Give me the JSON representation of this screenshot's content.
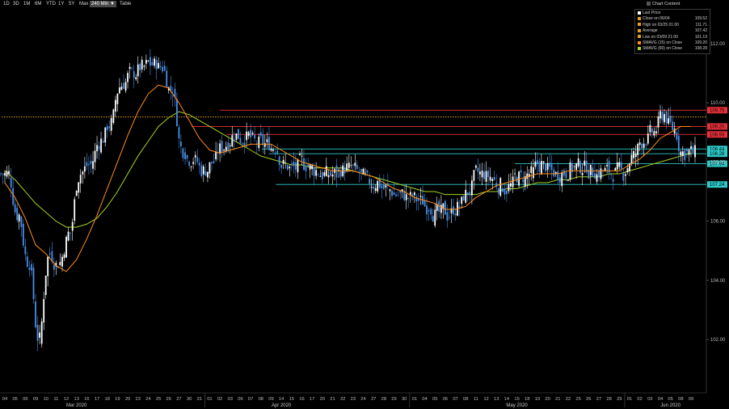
{
  "toolbar": {
    "ranges": [
      "1D",
      "3D",
      "1M",
      "6M",
      "YTD",
      "1Y",
      "5Y",
      "Max"
    ],
    "interval": "240 Min ▼",
    "table": "Table",
    "chart_content": "Chart Content"
  },
  "legend": {
    "rows": [
      {
        "label": "Last Price",
        "value": "",
        "color": "#ffffff"
      },
      {
        "label": "Close on 06/04",
        "value": "109.52",
        "color": "#e8a020"
      },
      {
        "label": "High on 03/25 01:00",
        "value": "111.71",
        "color": "#e8a020"
      },
      {
        "label": "Average",
        "value": "107.42",
        "color": "#e8a020"
      },
      {
        "label": "Low on 03/09 21:00",
        "value": "101.19",
        "color": "#e8a020"
      },
      {
        "label": "SMAVG (15) on Close",
        "value": "109.20",
        "color": "#ff8c1a"
      },
      {
        "label": "SMAVG (60) on Close",
        "value": "108.28",
        "color": "#a6d61e"
      }
    ]
  },
  "colors": {
    "candle_up": "#ffffff",
    "candle_down": "#4a8fe8",
    "sma15": "#ff8c1a",
    "sma60": "#a6d61e",
    "resistance": "#e8303a",
    "support": "#2ec8c8"
  },
  "chart_data": {
    "type": "line",
    "ylim": [
      100.2,
      113.2
    ],
    "y_ticks": [
      "112.00",
      "110.00",
      "108.00",
      "106.00",
      "104.00",
      "102.00"
    ],
    "y_tick_values": [
      112,
      110,
      108,
      106,
      104,
      102
    ],
    "x_day_ticks": [
      "04",
      "05",
      "06",
      "09",
      "10",
      "11",
      "12",
      "13",
      "16",
      "17",
      "18",
      "19",
      "20",
      "23",
      "24",
      "25",
      "26",
      "27",
      "30",
      "31",
      "01",
      "02",
      "03",
      "06",
      "07",
      "08",
      "09",
      "14",
      "15",
      "16",
      "17",
      "20",
      "21",
      "22",
      "23",
      "24",
      "27",
      "28",
      "29",
      "30",
      "01",
      "04",
      "05",
      "06",
      "07",
      "08",
      "11",
      "12",
      "13",
      "14",
      "15",
      "18",
      "19",
      "20",
      "21",
      "22",
      "25",
      "26",
      "27",
      "28",
      "29",
      "01",
      "02",
      "03",
      "04",
      "05",
      "08",
      "09"
    ],
    "x_month_labels": [
      {
        "label": "Mar 2020",
        "index": 7
      },
      {
        "label": "Apr 2020",
        "index": 27
      },
      {
        "label": "May 2020",
        "index": 50
      },
      {
        "label": "Jun 2020",
        "index": 65
      }
    ],
    "dates": [
      "03/04",
      "03/05",
      "03/06",
      "03/09",
      "03/10",
      "03/11",
      "03/12",
      "03/13",
      "03/16",
      "03/17",
      "03/18",
      "03/19",
      "03/20",
      "03/23",
      "03/24",
      "03/25",
      "03/26",
      "03/27",
      "03/30",
      "03/31",
      "04/01",
      "04/02",
      "04/03",
      "04/06",
      "04/07",
      "04/08",
      "04/09",
      "04/14",
      "04/15",
      "04/16",
      "04/17",
      "04/20",
      "04/21",
      "04/22",
      "04/23",
      "04/24",
      "04/27",
      "04/28",
      "04/29",
      "04/30",
      "05/01",
      "05/04",
      "05/05",
      "05/06",
      "05/07",
      "05/08",
      "05/11",
      "05/12",
      "05/13",
      "05/14",
      "05/15",
      "05/18",
      "05/19",
      "05/20",
      "05/21",
      "05/22",
      "05/25",
      "05/26",
      "05/27",
      "05/28",
      "05/29",
      "06/01",
      "06/02",
      "06/03",
      "06/04",
      "06/05",
      "06/08",
      "06/09"
    ],
    "series": [
      {
        "values": [
          107.6,
          106.2,
          104.6,
          102.0,
          104.9,
          104.6,
          105.6,
          107.6,
          107.9,
          108.7,
          109.3,
          110.6,
          111.0,
          111.2,
          111.3,
          111.2,
          110.4,
          108.4,
          108.1,
          107.7,
          108.0,
          108.5,
          108.9,
          108.8,
          108.7,
          108.6,
          108.5,
          107.9,
          107.8,
          107.9,
          107.7,
          107.6,
          107.6,
          107.8,
          107.7,
          107.4,
          107.3,
          107.1,
          106.9,
          106.8,
          106.7,
          106.5,
          106.3,
          106.2,
          106.5,
          107.0,
          107.6,
          107.5,
          107.2,
          107.2,
          107.5,
          107.6,
          107.9,
          107.7,
          107.6,
          107.8,
          107.8,
          107.7,
          107.7,
          107.6,
          107.6,
          108.2,
          108.7,
          109.0,
          109.6,
          109.1,
          108.3,
          108.3
        ]
      },
      {
        "values": [
          107.3,
          106.8,
          106.1,
          105.2,
          104.9,
          104.5,
          104.3,
          104.7,
          105.4,
          106.2,
          107.1,
          108.0,
          108.9,
          109.7,
          110.3,
          110.6,
          110.5,
          110.0,
          109.4,
          108.8,
          108.4,
          108.3,
          108.4,
          108.5,
          108.6,
          108.6,
          108.6,
          108.4,
          108.2,
          108.0,
          107.9,
          107.8,
          107.7,
          107.7,
          107.7,
          107.6,
          107.5,
          107.3,
          107.1,
          107.0,
          106.8,
          106.7,
          106.6,
          106.4,
          106.4,
          106.5,
          106.8,
          107.0,
          107.2,
          107.3,
          107.4,
          107.5,
          107.6,
          107.6,
          107.6,
          107.7,
          107.7,
          107.7,
          107.7,
          107.7,
          107.7,
          107.9,
          108.1,
          108.4,
          108.8,
          109.0,
          109.2,
          109.2
        ]
      },
      {
        "values": [
          107.7,
          107.4,
          107.0,
          106.6,
          106.3,
          106.0,
          105.8,
          105.8,
          105.9,
          106.1,
          106.5,
          107.0,
          107.6,
          108.2,
          108.7,
          109.2,
          109.5,
          109.7,
          109.6,
          109.4,
          109.2,
          109.0,
          108.8,
          108.6,
          108.4,
          108.2,
          108.1,
          108.0,
          107.9,
          107.9,
          107.8,
          107.8,
          107.8,
          107.8,
          107.7,
          107.6,
          107.5,
          107.4,
          107.3,
          107.2,
          107.1,
          107.0,
          107.0,
          106.9,
          106.9,
          106.9,
          106.9,
          107.0,
          107.0,
          107.1,
          107.1,
          107.2,
          107.3,
          107.3,
          107.4,
          107.4,
          107.5,
          107.5,
          107.5,
          107.6,
          107.6,
          107.7,
          107.8,
          107.9,
          108.0,
          108.1,
          108.2,
          108.3
        ]
      }
    ],
    "h_lines": [
      {
        "value": "109.75",
        "y": 109.75,
        "color": "#e8303a",
        "style": "solid",
        "from": 0.31
      },
      {
        "value": "",
        "y": 109.52,
        "color": "#e8a020",
        "style": "dotted",
        "from": 0.0
      },
      {
        "value": "109.20",
        "y": 109.2,
        "color": "#e8303a",
        "style": "solid",
        "from": 0.27
      },
      {
        "value": "108.93",
        "y": 108.93,
        "color": "#e8303a",
        "style": "solid",
        "from": 0.32
      },
      {
        "value": "108.44",
        "y": 108.44,
        "color": "#2ec8c8",
        "style": "solid",
        "from": 0.37
      },
      {
        "value": "108.28",
        "y": 108.28,
        "color": "#2ec8c8",
        "style": "solid",
        "from": 0.38
      },
      {
        "value": "107.94",
        "y": 107.94,
        "color": "#2ec8c8",
        "style": "solid",
        "from": 0.73
      },
      {
        "value": "107.24",
        "y": 107.24,
        "color": "#2ec8c8",
        "style": "solid",
        "from": 0.39
      }
    ]
  }
}
